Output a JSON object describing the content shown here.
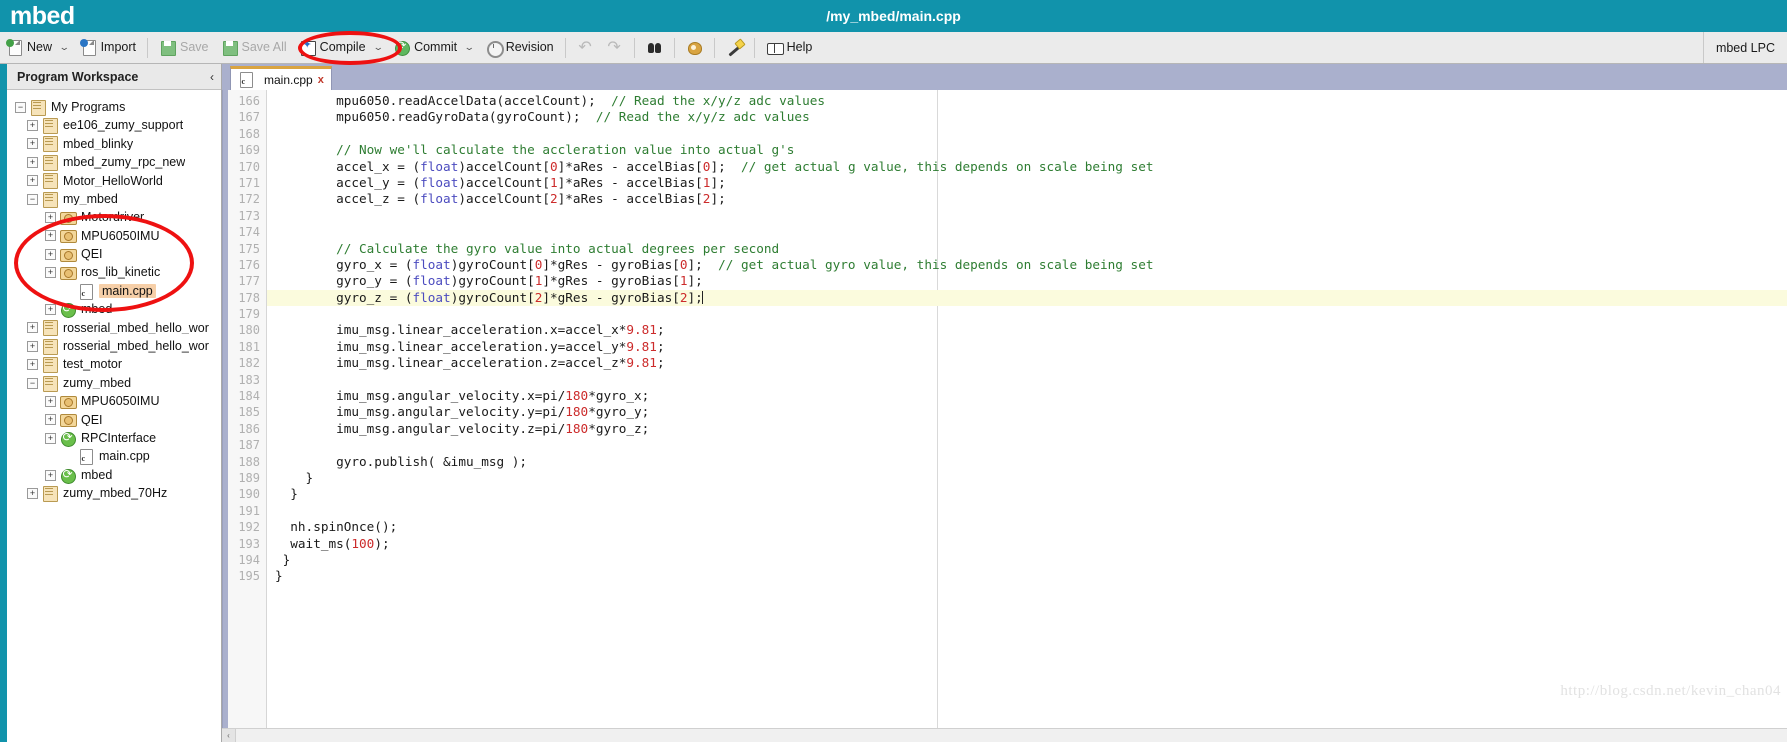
{
  "header": {
    "brand": "mbed",
    "doc_path": "/my_mbed/main.cpp",
    "accent_color": "#1193ab"
  },
  "toolbar": {
    "new_label": "New",
    "import_label": "Import",
    "save_label": "Save",
    "save_all_label": "Save All",
    "compile_label": "Compile",
    "commit_label": "Commit",
    "revision_label": "Revision",
    "help_label": "Help",
    "caret": "⌄",
    "undo_icon": "↶",
    "redo_icon": "↷",
    "platform": "mbed LPC"
  },
  "sidebar": {
    "title": "Program Workspace",
    "collapse_icon": "‹",
    "tree": [
      {
        "label": "My Programs",
        "indent": 0,
        "twisty": "−",
        "icon": "programs-root-icon",
        "selected": false
      },
      {
        "label": "ee106_zumy_support",
        "indent": 1,
        "twisty": "+",
        "icon": "program-icon",
        "selected": false
      },
      {
        "label": "mbed_blinky",
        "indent": 1,
        "twisty": "+",
        "icon": "program-icon",
        "selected": false
      },
      {
        "label": "mbed_zumy_rpc_new",
        "indent": 1,
        "twisty": "+",
        "icon": "program-icon",
        "selected": false
      },
      {
        "label": "Motor_HelloWorld",
        "indent": 1,
        "twisty": "+",
        "icon": "program-icon",
        "selected": false
      },
      {
        "label": "my_mbed",
        "indent": 1,
        "twisty": "−",
        "icon": "program-icon",
        "selected": false
      },
      {
        "label": "Motordriver",
        "indent": 2,
        "twisty": "+",
        "icon": "library-icon",
        "selected": false
      },
      {
        "label": "MPU6050IMU",
        "indent": 2,
        "twisty": "+",
        "icon": "library-icon",
        "selected": false
      },
      {
        "label": "QEI",
        "indent": 2,
        "twisty": "+",
        "icon": "library-icon",
        "selected": false
      },
      {
        "label": "ros_lib_kinetic",
        "indent": 2,
        "twisty": "+",
        "icon": "library-icon",
        "selected": false
      },
      {
        "label": "main.cpp",
        "indent": 3,
        "twisty": "",
        "icon": "source-file-icon",
        "selected": true
      },
      {
        "label": "mbed",
        "indent": 2,
        "twisty": "+",
        "icon": "mbed-library-icon",
        "selected": false
      },
      {
        "label": "rosserial_mbed_hello_wor",
        "indent": 1,
        "twisty": "+",
        "icon": "program-icon",
        "selected": false
      },
      {
        "label": "rosserial_mbed_hello_wor",
        "indent": 1,
        "twisty": "+",
        "icon": "program-icon",
        "selected": false
      },
      {
        "label": "test_motor",
        "indent": 1,
        "twisty": "+",
        "icon": "program-icon",
        "selected": false
      },
      {
        "label": "zumy_mbed",
        "indent": 1,
        "twisty": "−",
        "icon": "program-icon",
        "selected": false
      },
      {
        "label": "MPU6050IMU",
        "indent": 2,
        "twisty": "+",
        "icon": "library-icon",
        "selected": false
      },
      {
        "label": "QEI",
        "indent": 2,
        "twisty": "+",
        "icon": "library-icon",
        "selected": false
      },
      {
        "label": "RPCInterface",
        "indent": 2,
        "twisty": "+",
        "icon": "mbed-library-icon",
        "selected": false
      },
      {
        "label": "main.cpp",
        "indent": 3,
        "twisty": "",
        "icon": "source-file-icon",
        "selected": false
      },
      {
        "label": "mbed",
        "indent": 2,
        "twisty": "+",
        "icon": "mbed-library-icon",
        "selected": false
      },
      {
        "label": "zumy_mbed_70Hz",
        "indent": 1,
        "twisty": "+",
        "icon": "program-icon",
        "selected": false
      }
    ]
  },
  "editor": {
    "tab_label": "main.cpp",
    "tab_close": "x",
    "active_line": 178,
    "first_line": 166,
    "lines": [
      {
        "n": 166,
        "tokens": [
          {
            "t": "        mpu6050.readAccelData(accelCount);  ",
            "c": ""
          },
          {
            "t": "// Read the x/y/z adc values",
            "c": "cmt"
          }
        ]
      },
      {
        "n": 167,
        "tokens": [
          {
            "t": "        mpu6050.readGyroData(gyroCount);  ",
            "c": ""
          },
          {
            "t": "// Read the x/y/z adc values",
            "c": "cmt"
          }
        ]
      },
      {
        "n": 168,
        "tokens": []
      },
      {
        "n": 169,
        "tokens": [
          {
            "t": "        ",
            "c": ""
          },
          {
            "t": "// Now we'll calculate the accleration value into actual g's",
            "c": "cmt"
          }
        ]
      },
      {
        "n": 170,
        "tokens": [
          {
            "t": "        accel_x = (",
            "c": ""
          },
          {
            "t": "float",
            "c": "kw"
          },
          {
            "t": ")accelCount[",
            "c": ""
          },
          {
            "t": "0",
            "c": "num"
          },
          {
            "t": "]*aRes - accelBias[",
            "c": ""
          },
          {
            "t": "0",
            "c": "num"
          },
          {
            "t": "];  ",
            "c": ""
          },
          {
            "t": "// get actual g value, this depends on scale being set",
            "c": "cmt"
          }
        ]
      },
      {
        "n": 171,
        "tokens": [
          {
            "t": "        accel_y = (",
            "c": ""
          },
          {
            "t": "float",
            "c": "kw"
          },
          {
            "t": ")accelCount[",
            "c": ""
          },
          {
            "t": "1",
            "c": "num"
          },
          {
            "t": "]*aRes - accelBias[",
            "c": ""
          },
          {
            "t": "1",
            "c": "num"
          },
          {
            "t": "];",
            "c": ""
          }
        ]
      },
      {
        "n": 172,
        "tokens": [
          {
            "t": "        accel_z = (",
            "c": ""
          },
          {
            "t": "float",
            "c": "kw"
          },
          {
            "t": ")accelCount[",
            "c": ""
          },
          {
            "t": "2",
            "c": "num"
          },
          {
            "t": "]*aRes - accelBias[",
            "c": ""
          },
          {
            "t": "2",
            "c": "num"
          },
          {
            "t": "];",
            "c": ""
          }
        ]
      },
      {
        "n": 173,
        "tokens": []
      },
      {
        "n": 174,
        "tokens": []
      },
      {
        "n": 175,
        "tokens": [
          {
            "t": "        ",
            "c": ""
          },
          {
            "t": "// Calculate the gyro value into actual degrees per second",
            "c": "cmt"
          }
        ]
      },
      {
        "n": 176,
        "tokens": [
          {
            "t": "        gyro_x = (",
            "c": ""
          },
          {
            "t": "float",
            "c": "kw"
          },
          {
            "t": ")gyroCount[",
            "c": ""
          },
          {
            "t": "0",
            "c": "num"
          },
          {
            "t": "]*gRes - gyroBias[",
            "c": ""
          },
          {
            "t": "0",
            "c": "num"
          },
          {
            "t": "];  ",
            "c": ""
          },
          {
            "t": "// get actual gyro value, this depends on scale being set",
            "c": "cmt"
          }
        ]
      },
      {
        "n": 177,
        "tokens": [
          {
            "t": "        gyro_y = (",
            "c": ""
          },
          {
            "t": "float",
            "c": "kw"
          },
          {
            "t": ")gyroCount[",
            "c": ""
          },
          {
            "t": "1",
            "c": "num"
          },
          {
            "t": "]*gRes - gyroBias[",
            "c": ""
          },
          {
            "t": "1",
            "c": "num"
          },
          {
            "t": "];",
            "c": ""
          }
        ]
      },
      {
        "n": 178,
        "tokens": [
          {
            "t": "        gyro_z = (",
            "c": ""
          },
          {
            "t": "float",
            "c": "kw"
          },
          {
            "t": ")gyroCount[",
            "c": ""
          },
          {
            "t": "2",
            "c": "num"
          },
          {
            "t": "]*gRes - gyroBias[",
            "c": ""
          },
          {
            "t": "2",
            "c": "num"
          },
          {
            "t": "];",
            "c": ""
          }
        ],
        "caret": true
      },
      {
        "n": 179,
        "tokens": []
      },
      {
        "n": 180,
        "tokens": [
          {
            "t": "        imu_msg.linear_acceleration.x=accel_x*",
            "c": ""
          },
          {
            "t": "9.81",
            "c": "num"
          },
          {
            "t": ";",
            "c": ""
          }
        ]
      },
      {
        "n": 181,
        "tokens": [
          {
            "t": "        imu_msg.linear_acceleration.y=accel_y*",
            "c": ""
          },
          {
            "t": "9.81",
            "c": "num"
          },
          {
            "t": ";",
            "c": ""
          }
        ]
      },
      {
        "n": 182,
        "tokens": [
          {
            "t": "        imu_msg.linear_acceleration.z=accel_z*",
            "c": ""
          },
          {
            "t": "9.81",
            "c": "num"
          },
          {
            "t": ";",
            "c": ""
          }
        ]
      },
      {
        "n": 183,
        "tokens": []
      },
      {
        "n": 184,
        "tokens": [
          {
            "t": "        imu_msg.angular_velocity.x=pi/",
            "c": ""
          },
          {
            "t": "180",
            "c": "num"
          },
          {
            "t": "*gyro_x;",
            "c": ""
          }
        ]
      },
      {
        "n": 185,
        "tokens": [
          {
            "t": "        imu_msg.angular_velocity.y=pi/",
            "c": ""
          },
          {
            "t": "180",
            "c": "num"
          },
          {
            "t": "*gyro_y;",
            "c": ""
          }
        ]
      },
      {
        "n": 186,
        "tokens": [
          {
            "t": "        imu_msg.angular_velocity.z=pi/",
            "c": ""
          },
          {
            "t": "180",
            "c": "num"
          },
          {
            "t": "*gyro_z;",
            "c": ""
          }
        ]
      },
      {
        "n": 187,
        "tokens": []
      },
      {
        "n": 188,
        "tokens": [
          {
            "t": "        gyro.publish( &imu_msg );",
            "c": ""
          }
        ]
      },
      {
        "n": 189,
        "tokens": [
          {
            "t": "    }",
            "c": ""
          }
        ]
      },
      {
        "n": 190,
        "tokens": [
          {
            "t": "  }",
            "c": ""
          }
        ]
      },
      {
        "n": 191,
        "tokens": []
      },
      {
        "n": 192,
        "tokens": [
          {
            "t": "  nh.spinOnce();",
            "c": ""
          }
        ]
      },
      {
        "n": 193,
        "tokens": [
          {
            "t": "  wait_ms(",
            "c": ""
          },
          {
            "t": "100",
            "c": "num"
          },
          {
            "t": ");",
            "c": ""
          }
        ]
      },
      {
        "n": 194,
        "tokens": [
          {
            "t": " }",
            "c": ""
          }
        ]
      },
      {
        "n": 195,
        "tokens": [
          {
            "t": "}",
            "c": ""
          }
        ]
      }
    ]
  },
  "scrollbar": {
    "left_arrow": "‹",
    "right_arrow": "›"
  },
  "watermark": "http://blog.csdn.net/kevin_chan04",
  "annotations": {
    "color": "#ee1111",
    "items": [
      "compile-button-highlight",
      "my-mbed-tree-highlight"
    ]
  }
}
